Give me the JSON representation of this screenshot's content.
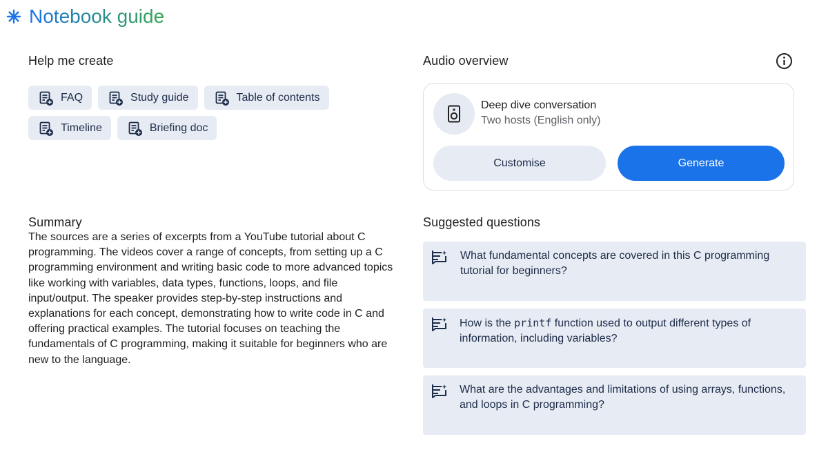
{
  "header": {
    "title": "Notebook guide",
    "icon": "sparkle-icon",
    "accent_start": "#1a73e8",
    "accent_end": "#34a853"
  },
  "help_me_create": {
    "title": "Help me create",
    "chips": [
      {
        "label": "FAQ",
        "icon": "note-add-icon"
      },
      {
        "label": "Study guide",
        "icon": "note-add-icon"
      },
      {
        "label": "Table of contents",
        "icon": "note-add-icon"
      },
      {
        "label": "Timeline",
        "icon": "note-add-icon"
      },
      {
        "label": "Briefing doc",
        "icon": "note-add-icon"
      }
    ]
  },
  "audio_overview": {
    "title": "Audio overview",
    "info_icon": "info-icon",
    "card": {
      "icon": "speaker-icon",
      "title": "Deep dive conversation",
      "subtitle": "Two hosts (English only)",
      "customise_label": "Customise",
      "generate_label": "Generate",
      "generate_color": "#1a73e8"
    }
  },
  "summary": {
    "title": "Summary",
    "text": "The sources are a series of excerpts from a YouTube tutorial about C programming. The videos cover a range of concepts, from setting up a C programming environment and writing basic code to more advanced topics like working with variables, data types, functions, loops, and file input/output. The speaker provides step-by-step instructions and explanations for each concept, demonstrating how to write code in C and offering practical examples. The tutorial focuses on teaching the fundamentals of C programming, making it suitable for beginners who are new to the language."
  },
  "suggested_questions": {
    "title": "Suggested questions",
    "items": [
      {
        "text": "What fundamental concepts are covered in this C programming tutorial for beginners?",
        "icon": "question-list-icon"
      },
      {
        "text_before": "How is the ",
        "code": "printf",
        "text_after": " function used to output different types of information, including variables?",
        "icon": "question-list-icon"
      },
      {
        "text": "What are the advantages and limitations of using arrays, functions, and loops in C programming?",
        "icon": "question-list-icon"
      }
    ]
  }
}
